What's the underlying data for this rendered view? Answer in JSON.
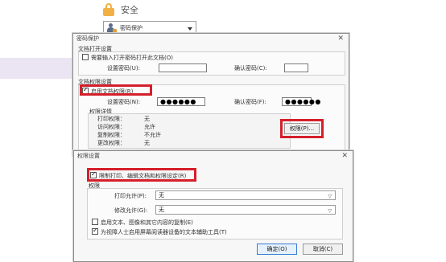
{
  "security": {
    "title": "安全",
    "select_value": "密码保护"
  },
  "password_dialog": {
    "title": "密码保护",
    "open_group": {
      "title": "文档打开设置",
      "require_open_password": "需要输入打开密码打开此文档(O)",
      "set_password_label": "设置密码(U):",
      "confirm_password_label": "确认密码(C):"
    },
    "permission_group": {
      "title": "文档权限设置",
      "restrict_label": "启用文档权限(R)",
      "set_password_label": "设置密码(N):",
      "set_password_value": "●●●●●●",
      "confirm_password_label": "确认密码(F):",
      "confirm_password_value": "●●●●●●",
      "details_title": "权限详情",
      "print_label": "打印权限：",
      "print_value": "无",
      "access_label": "访问权限：",
      "access_value": "允许",
      "copy_label": "复制权限：",
      "copy_value": "不允许",
      "change_label": "更改权限：",
      "change_value": "无",
      "permissions_button": "权限(P)..."
    }
  },
  "perm_dialog": {
    "title": "权限设置",
    "restrict_label": "限制打印、编辑文档和权限设定(R)",
    "group_title": "权限",
    "print_allowed_label": "打印允许(P):",
    "print_allowed_value": "无",
    "change_allowed_label": "修改允许(G):",
    "change_allowed_value": "无",
    "copy_option": "启用文本、图像和其它内容的复制(E)",
    "accessibility_option": "为视障人士启用屏幕阅读器设备的文本辅助工具(T)",
    "ok_button": "确定(O)",
    "cancel_button": "取消(C)"
  },
  "colors": {
    "highlight": "#d51f2a",
    "lock": "#f1b142"
  }
}
